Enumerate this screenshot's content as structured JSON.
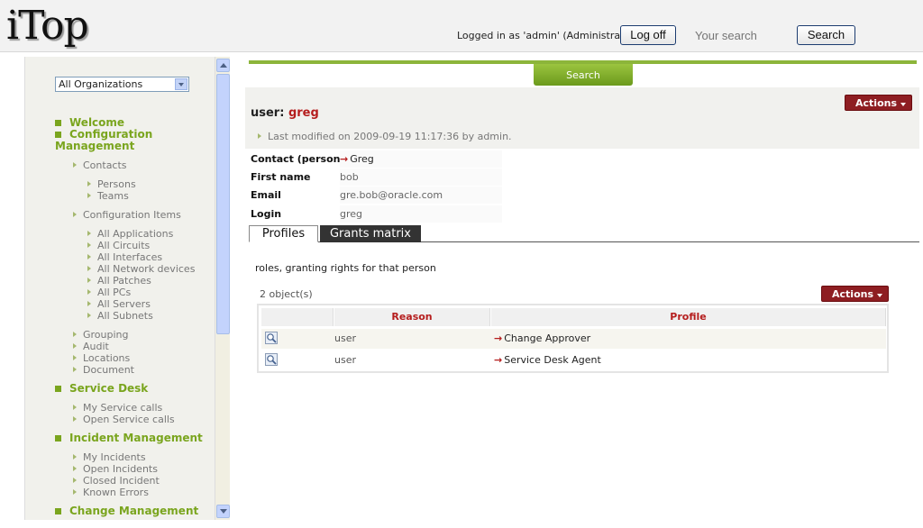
{
  "header": {
    "logo": "iTop",
    "logged_in_text": "Logged in as 'admin' (Administrator)",
    "logoff_label": "Log off",
    "search_placeholder": "Your search",
    "search_button": "Search"
  },
  "sidebar": {
    "org_select": "All Organizations",
    "headings": {
      "welcome": "Welcome",
      "config_mgmt": "Configuration",
      "config_mgmt2": "Management",
      "service_desk": "Service Desk",
      "incident_mgmt": "Incident Management",
      "change_mgmt": "Change Management"
    },
    "items": {
      "contacts": "Contacts",
      "persons": "Persons",
      "teams": "Teams",
      "config_items": "Configuration Items",
      "all_applications": "All Applications",
      "all_circuits": "All Circuits",
      "all_interfaces": "All Interfaces",
      "all_network_devices": "All Network devices",
      "all_patches": "All Patches",
      "all_pcs": "All PCs",
      "all_servers": "All Servers",
      "all_subnets": "All Subnets",
      "grouping": "Grouping",
      "audit": "Audit",
      "locations": "Locations",
      "document": "Document",
      "my_service_calls": "My Service calls",
      "open_service_calls": "Open Service calls",
      "my_incidents": "My Incidents",
      "open_incidents": "Open Incidents",
      "closed_incident": "Closed Incident",
      "known_errors": "Known Errors"
    }
  },
  "main": {
    "search_tab": "Search",
    "title_prefix": "user:",
    "title_value": "greg",
    "last_modified": "Last modified on 2009-09-19 11:17:36 by admin.",
    "actions_label": "Actions",
    "properties": {
      "contact_label": "Contact (person)",
      "contact_value": "Greg",
      "first_name_label": "First name",
      "first_name_value": "bob",
      "email_label": "Email",
      "email_value": "gre.bob@oracle.com",
      "login_label": "Login",
      "login_value": "greg"
    },
    "tabs": {
      "profiles": "Profiles",
      "grants_matrix": "Grants matrix"
    },
    "roles_description": "roles, granting rights for that person",
    "object_count": "2 object(s)",
    "table": {
      "headers": {
        "reason": "Reason",
        "profile": "Profile"
      },
      "rows": [
        {
          "reason": "user",
          "profile": "Change Approver"
        },
        {
          "reason": "user",
          "profile": "Service Desk Agent"
        }
      ]
    }
  },
  "colors": {
    "accent_green": "#8cb53a",
    "link_red": "#b51d1d",
    "actions_bg": "#8e1e22"
  }
}
